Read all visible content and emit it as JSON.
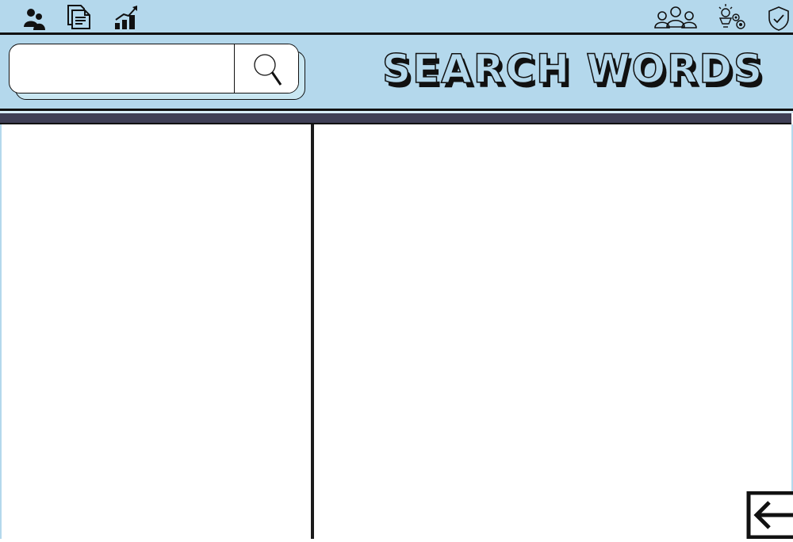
{
  "header": {
    "title": "SEARCH WORDS"
  },
  "search": {
    "value": "",
    "placeholder": ""
  },
  "toolbar": {
    "left_icons": [
      "users-icon",
      "document-icon",
      "growth-chart-icon"
    ],
    "right_icons": [
      "team-icon",
      "idea-settings-icon",
      "shield-check-icon"
    ]
  },
  "colors": {
    "header_bg": "#b4d8ec",
    "band": "#3f3f55",
    "border": "#111111",
    "panel_bg": "#ffffff"
  }
}
